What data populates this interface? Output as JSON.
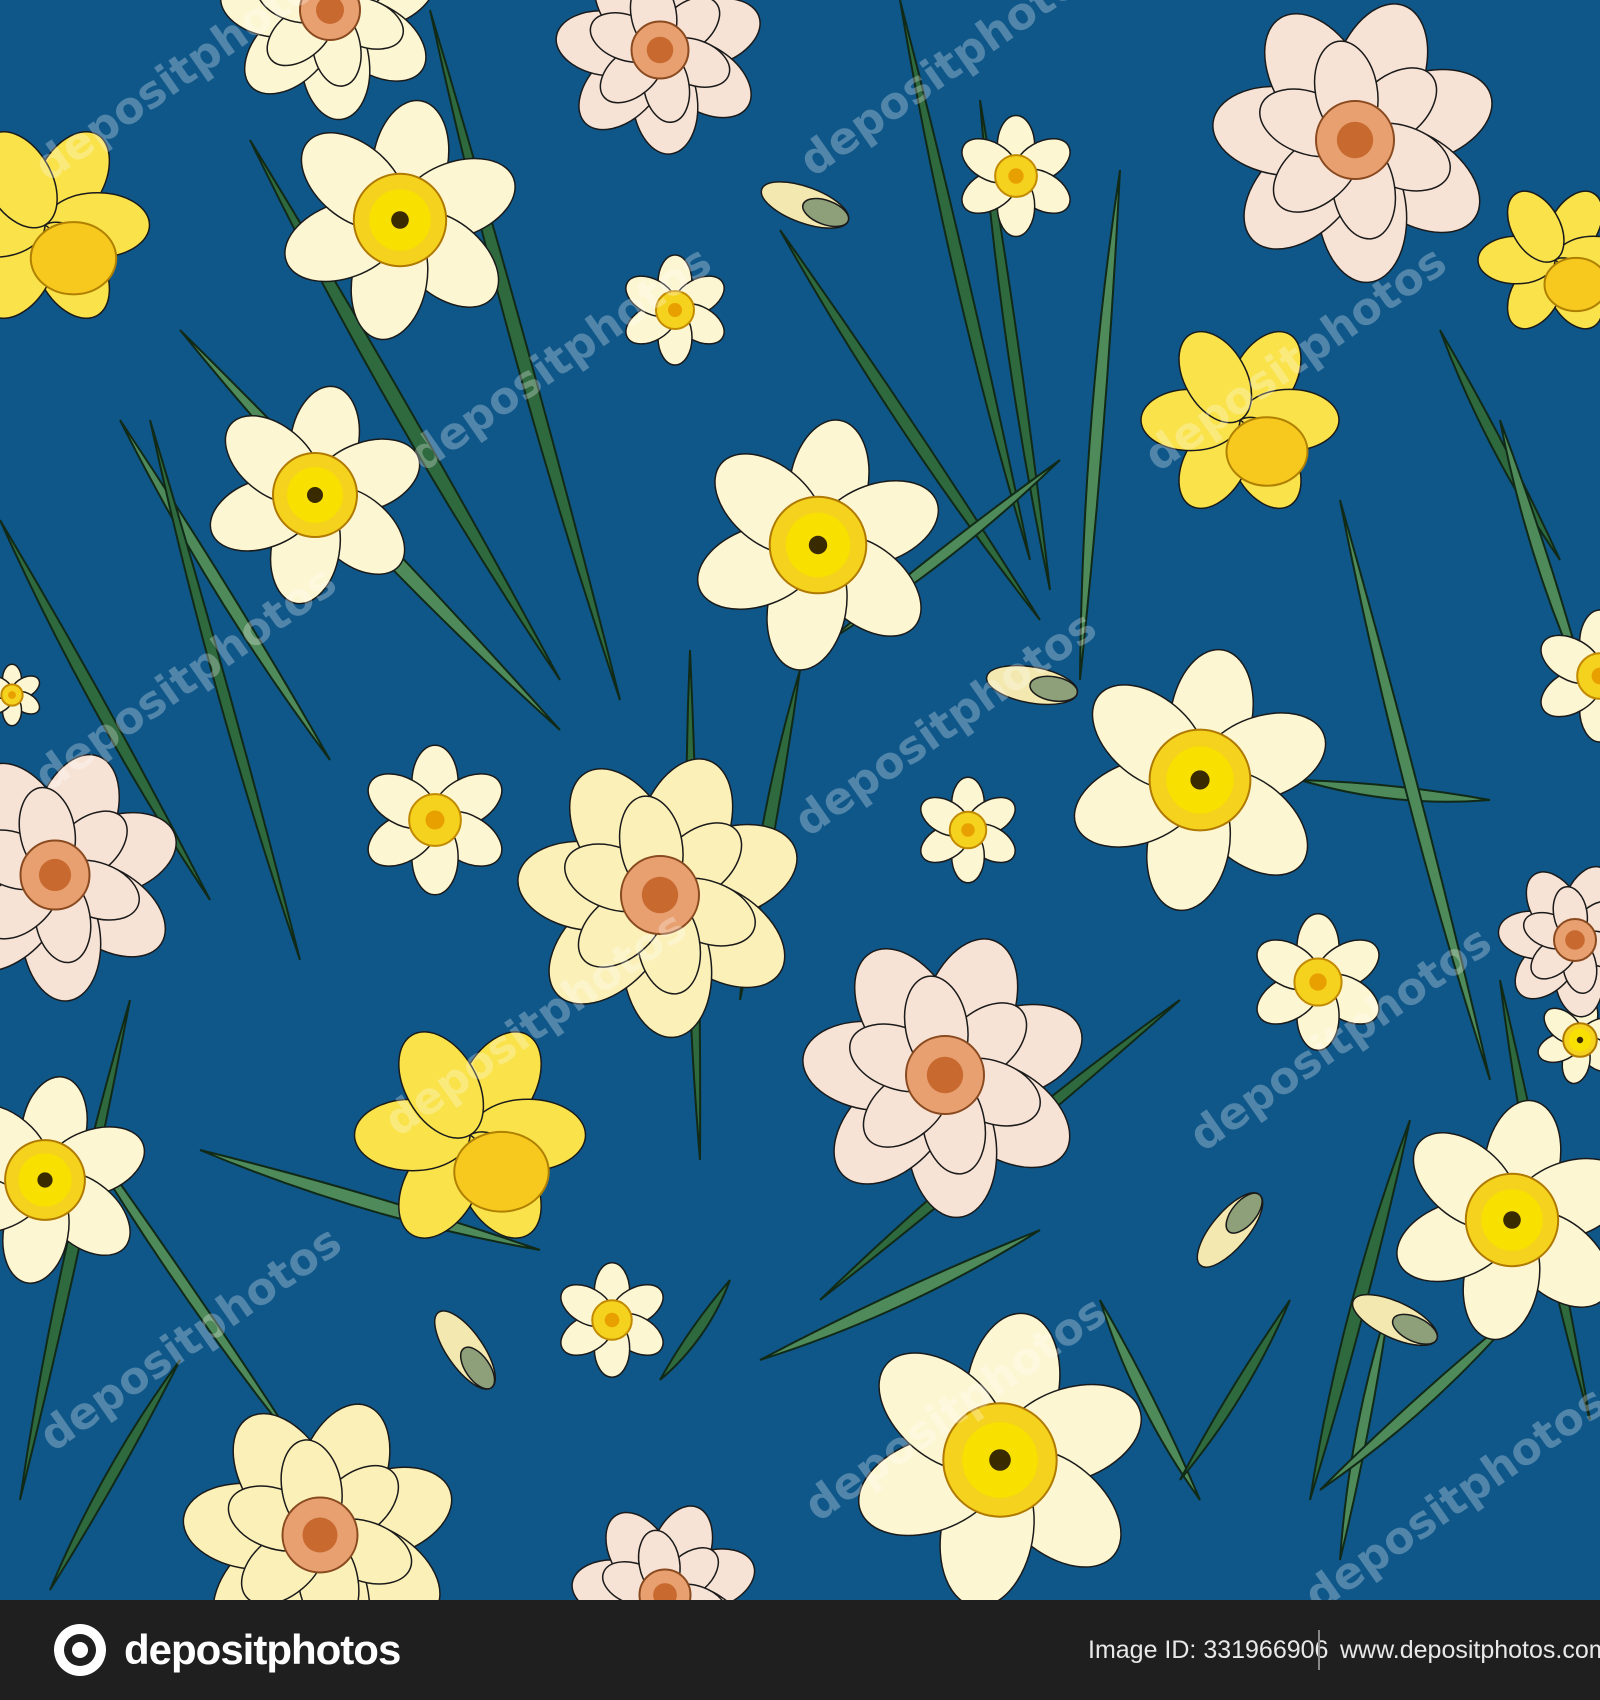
{
  "colors": {
    "background": "#0f5789",
    "leaf_dark": "#2f6a3f",
    "leaf_light": "#4f8a5a",
    "petal_cream": "#fdf6d2",
    "petal_blush": "#f7e3d6",
    "corona_yellow": "#f5d21e",
    "trumpet_yellow": "#f9e24a",
    "footer": "#1f1f1f"
  },
  "watermark": {
    "text": "depositphotos"
  },
  "footer": {
    "brand": "depositphotos",
    "image_id": "Image ID: 331966906",
    "site": "www.depositphotos.com",
    "icon": "depositphotos-logo-icon"
  }
}
